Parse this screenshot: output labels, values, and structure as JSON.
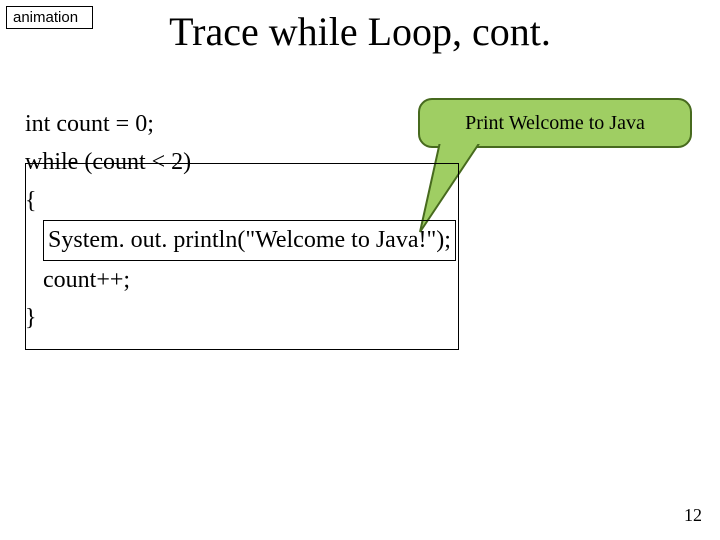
{
  "tag": "animation",
  "title": "Trace while Loop, cont.",
  "code": {
    "line1": "int count = 0;",
    "line2": "while (count < 2)",
    "brace_open": "{",
    "stmt_print": "System. out. println(\"Welcome to Java!\");",
    "stmt_inc": "count++;",
    "brace_close": "}"
  },
  "callout": "Print Welcome to Java",
  "page_number": "12"
}
